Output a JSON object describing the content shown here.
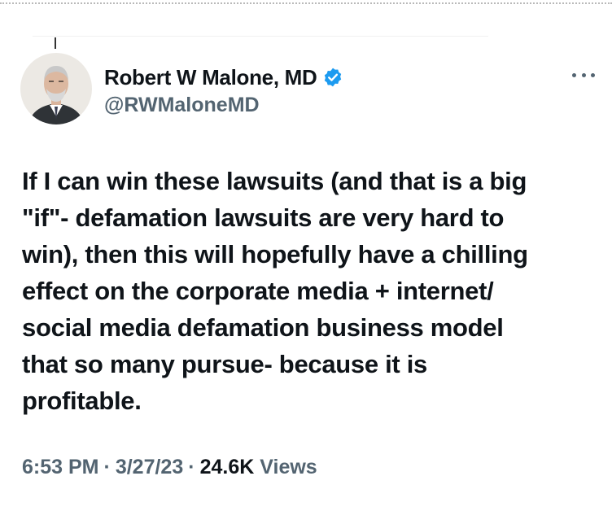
{
  "author": {
    "display_name": "Robert W Malone, MD",
    "handle": "@RWMaloneMD",
    "verified": true
  },
  "icons": {
    "verified": "verified-badge-icon",
    "more": "more-options-icon"
  },
  "tweet": {
    "text_lines": [
      "If I can win these lawsuits (and that is a big",
      "\"if\"- defamation lawsuits are very hard to",
      "win), then this will hopefully have a chilling",
      "effect on the corporate media + internet/",
      "social media defamation business model",
      "that so many pursue- because it is",
      "profitable."
    ]
  },
  "meta": {
    "time": "6:53 PM",
    "separator": "·",
    "date": "3/27/23",
    "views_count": "24.6K",
    "views_label": "Views"
  },
  "colors": {
    "text_primary": "#0f1419",
    "text_secondary": "#536471",
    "verified_blue": "#1d9bf0"
  }
}
